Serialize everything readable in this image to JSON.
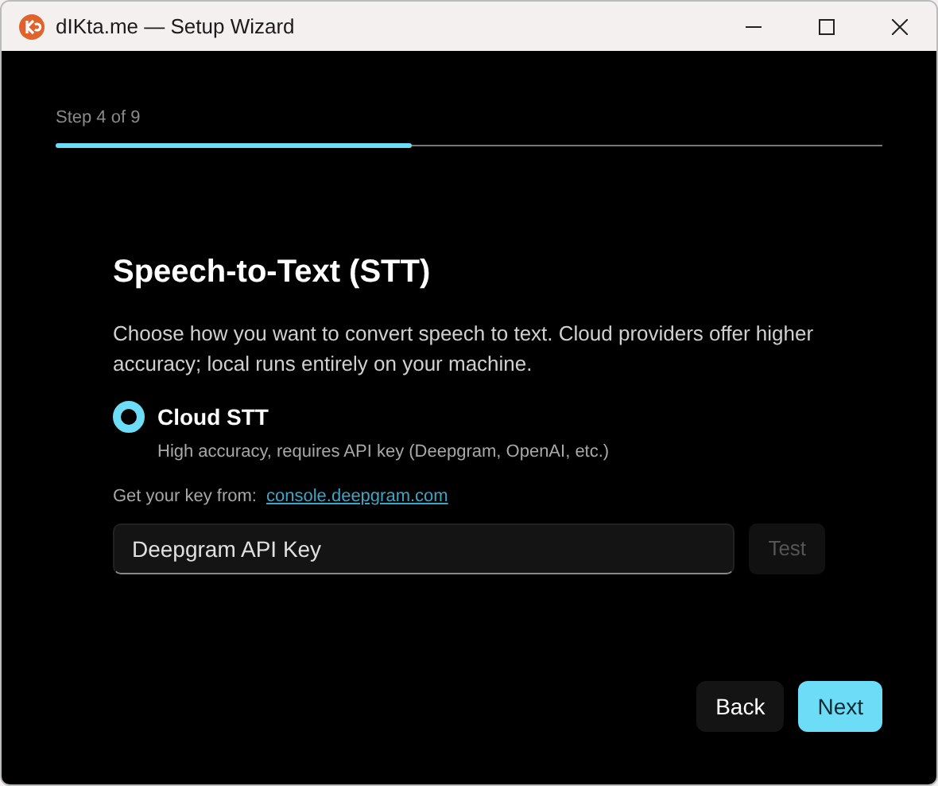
{
  "window": {
    "title": "dIKta.me — Setup Wizard"
  },
  "progress": {
    "step_label": "Step 4 of 9",
    "level": 0.43
  },
  "heading": "Speech-to-Text (STT)",
  "description": "Choose how you want to convert speech to text. Cloud providers offer higher accuracy; local runs entirely on your machine.",
  "options": [
    {
      "label": "Cloud STT",
      "description": "High accuracy, requires API key (Deepgram, OpenAI, etc.)",
      "selected": true
    }
  ],
  "key_hint": {
    "text": "Get your key from:",
    "link": "console.deepgram.com"
  },
  "api_key": {
    "placeholder": "Deepgram API Key"
  },
  "test_button": {
    "label": "Test",
    "disabled": true
  },
  "buttons": [
    {
      "label": "Back",
      "kind": "secondary"
    },
    {
      "label": "Next",
      "kind": "primary"
    }
  ]
}
